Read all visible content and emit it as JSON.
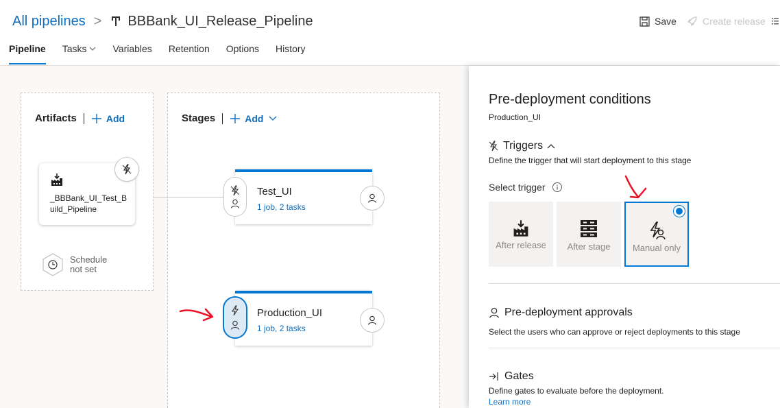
{
  "header": {
    "breadcrumb_root": "All pipelines",
    "breadcrumb_sep": ">",
    "pipeline_title": "BBBank_UI_Release_Pipeline",
    "save_label": "Save",
    "create_release_label": "Create release"
  },
  "tabs": [
    {
      "label": "Pipeline",
      "active": true
    },
    {
      "label": "Tasks",
      "active": false
    },
    {
      "label": "Variables",
      "active": false
    },
    {
      "label": "Retention",
      "active": false
    },
    {
      "label": "Options",
      "active": false
    },
    {
      "label": "History",
      "active": false
    }
  ],
  "artifacts": {
    "heading": "Artifacts",
    "add_label": "Add",
    "artifact_name": "_BBBank_UI_Test_Build_Pipeline",
    "schedule_label": "Schedule not set"
  },
  "stages": {
    "heading": "Stages",
    "add_label": "Add",
    "items": [
      {
        "name": "Test_UI",
        "summary": "1 job, 2 tasks"
      },
      {
        "name": "Production_UI",
        "summary": "1 job, 2 tasks"
      }
    ]
  },
  "panel": {
    "title": "Pre-deployment conditions",
    "stage_name": "Production_UI",
    "triggers": {
      "heading": "Triggers",
      "description": "Define the trigger that will start deployment to this stage",
      "select_label": "Select trigger",
      "options": [
        {
          "label": "After release",
          "selected": false
        },
        {
          "label": "After stage",
          "selected": false
        },
        {
          "label": "Manual only",
          "selected": true
        }
      ]
    },
    "approvals": {
      "heading": "Pre-deployment approvals",
      "description": "Select the users who can approve or reject deployments to this stage"
    },
    "gates": {
      "heading": "Gates",
      "description": "Define gates to evaluate before the deployment.",
      "learn_more": "Learn more"
    }
  },
  "colors": {
    "accent": "#0078d4",
    "link": "#106ebe",
    "annotation": "#e81123"
  }
}
